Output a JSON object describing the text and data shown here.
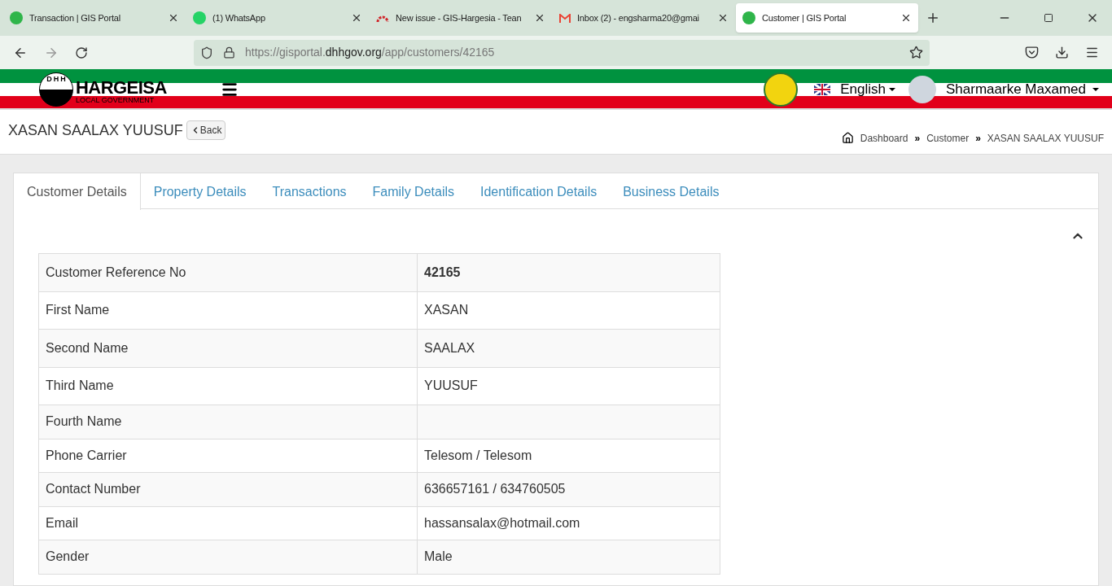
{
  "browser": {
    "tabs": [
      {
        "title": "Transaction | GIS Portal",
        "selected": false,
        "kind": "portal"
      },
      {
        "title": "(1) WhatsApp",
        "selected": false,
        "kind": "whatsapp"
      },
      {
        "title": "New issue - GIS-Hargesia - Tean",
        "selected": false,
        "kind": "issue"
      },
      {
        "title": "Inbox (2) - engsharma20@gmai",
        "selected": false,
        "kind": "mail"
      },
      {
        "title": "Customer | GIS Portal",
        "selected": true,
        "kind": "portal"
      }
    ],
    "url_prefix": "https://gisportal.",
    "url_domain": "dhhgov.org",
    "url_path": "/app/customers/42165"
  },
  "header": {
    "logo_letters": [
      "D",
      "H",
      "H"
    ],
    "logo_title": "HARGEISA",
    "logo_subtitle": "LOCAL GOVERNMENT",
    "language": "English",
    "user": "Sharmaarke Maxamed"
  },
  "page": {
    "title": "XASAN SAALAX YUUSUF",
    "back": "Back",
    "breadcrumb": [
      "Dashboard",
      "Customer",
      "XASAN SAALAX YUUSUF"
    ],
    "separator": "»"
  },
  "tabs": [
    {
      "label": "Customer Details",
      "selected": true
    },
    {
      "label": "Property Details",
      "selected": false
    },
    {
      "label": "Transactions",
      "selected": false
    },
    {
      "label": "Family Details",
      "selected": false
    },
    {
      "label": "Identification Details",
      "selected": false
    },
    {
      "label": "Business Details",
      "selected": false
    }
  ],
  "details": [
    {
      "label": "Customer Reference No",
      "value": "42165",
      "bold": true
    },
    {
      "label": "First Name",
      "value": "XASAN",
      "bold": false
    },
    {
      "label": "Second Name",
      "value": "SAALAX",
      "bold": false
    },
    {
      "label": "Third Name",
      "value": "YUUSUF",
      "bold": false
    },
    {
      "label": "Fourth Name"
    },
    {
      "label": "Phone Carrier",
      "value": "Telesom / Telesom",
      "bold": false
    },
    {
      "label": "Contact Number",
      "value": "636657161 / 634760505",
      "bold": false
    },
    {
      "label": "Email",
      "value": "hassansalax@hotmail.com",
      "bold": false
    },
    {
      "label": "Gender",
      "value": "Male",
      "bold": false
    }
  ]
}
